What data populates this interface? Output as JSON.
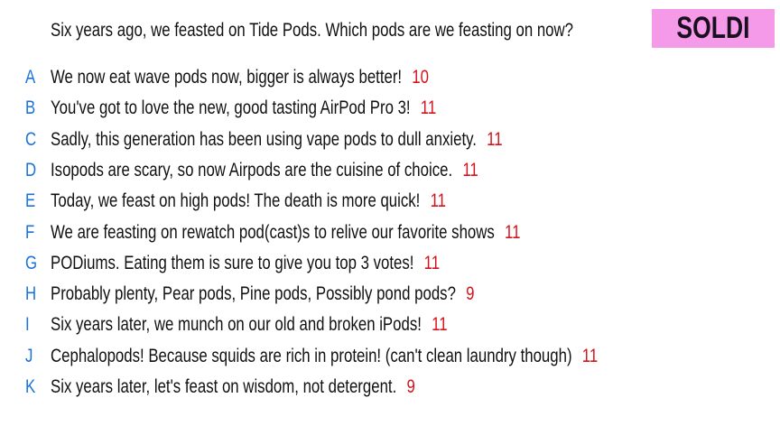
{
  "prompt": "Six years ago, we feasted on Tide Pods. Which pods are we feasting on now?",
  "badge": "SOLDI",
  "colors": {
    "letter": "#1a73d9",
    "votes": "#d4141c",
    "badge_bg": "#f59ae8"
  },
  "answers": [
    {
      "letter": "A",
      "text": "We now eat wave pods now, bigger is always better!",
      "votes": "10"
    },
    {
      "letter": "B",
      "text": "You've got to love the new, good tasting AirPod Pro 3!",
      "votes": "11"
    },
    {
      "letter": "C",
      "text": "Sadly, this generation has been using vape pods to dull anxiety.",
      "votes": "11"
    },
    {
      "letter": "D",
      "text": "Isopods are scary, so now Airpods are the cuisine of choice.",
      "votes": "11"
    },
    {
      "letter": "E",
      "text": "Today, we feast on high pods! The death is more quick!",
      "votes": "11"
    },
    {
      "letter": "F",
      "text": "We are feasting on rewatch pod(cast)s to relive our favorite shows",
      "votes": "11"
    },
    {
      "letter": "G",
      "text": "PODiums. Eating them is sure to give you top 3 votes!",
      "votes": "11"
    },
    {
      "letter": "H",
      "text": "Probably plenty, Pear pods, Pine pods, Possibly pond pods?",
      "votes": "9"
    },
    {
      "letter": "I",
      "text": "Six years later, we munch on our old and broken iPods!",
      "votes": "11"
    },
    {
      "letter": "J",
      "text": "Cephalopods! Because squids are rich in protein! (can't clean laundry though)",
      "votes": "11"
    },
    {
      "letter": "K",
      "text": "Six years later, let's feast on wisdom, not detergent.",
      "votes": "9"
    }
  ]
}
